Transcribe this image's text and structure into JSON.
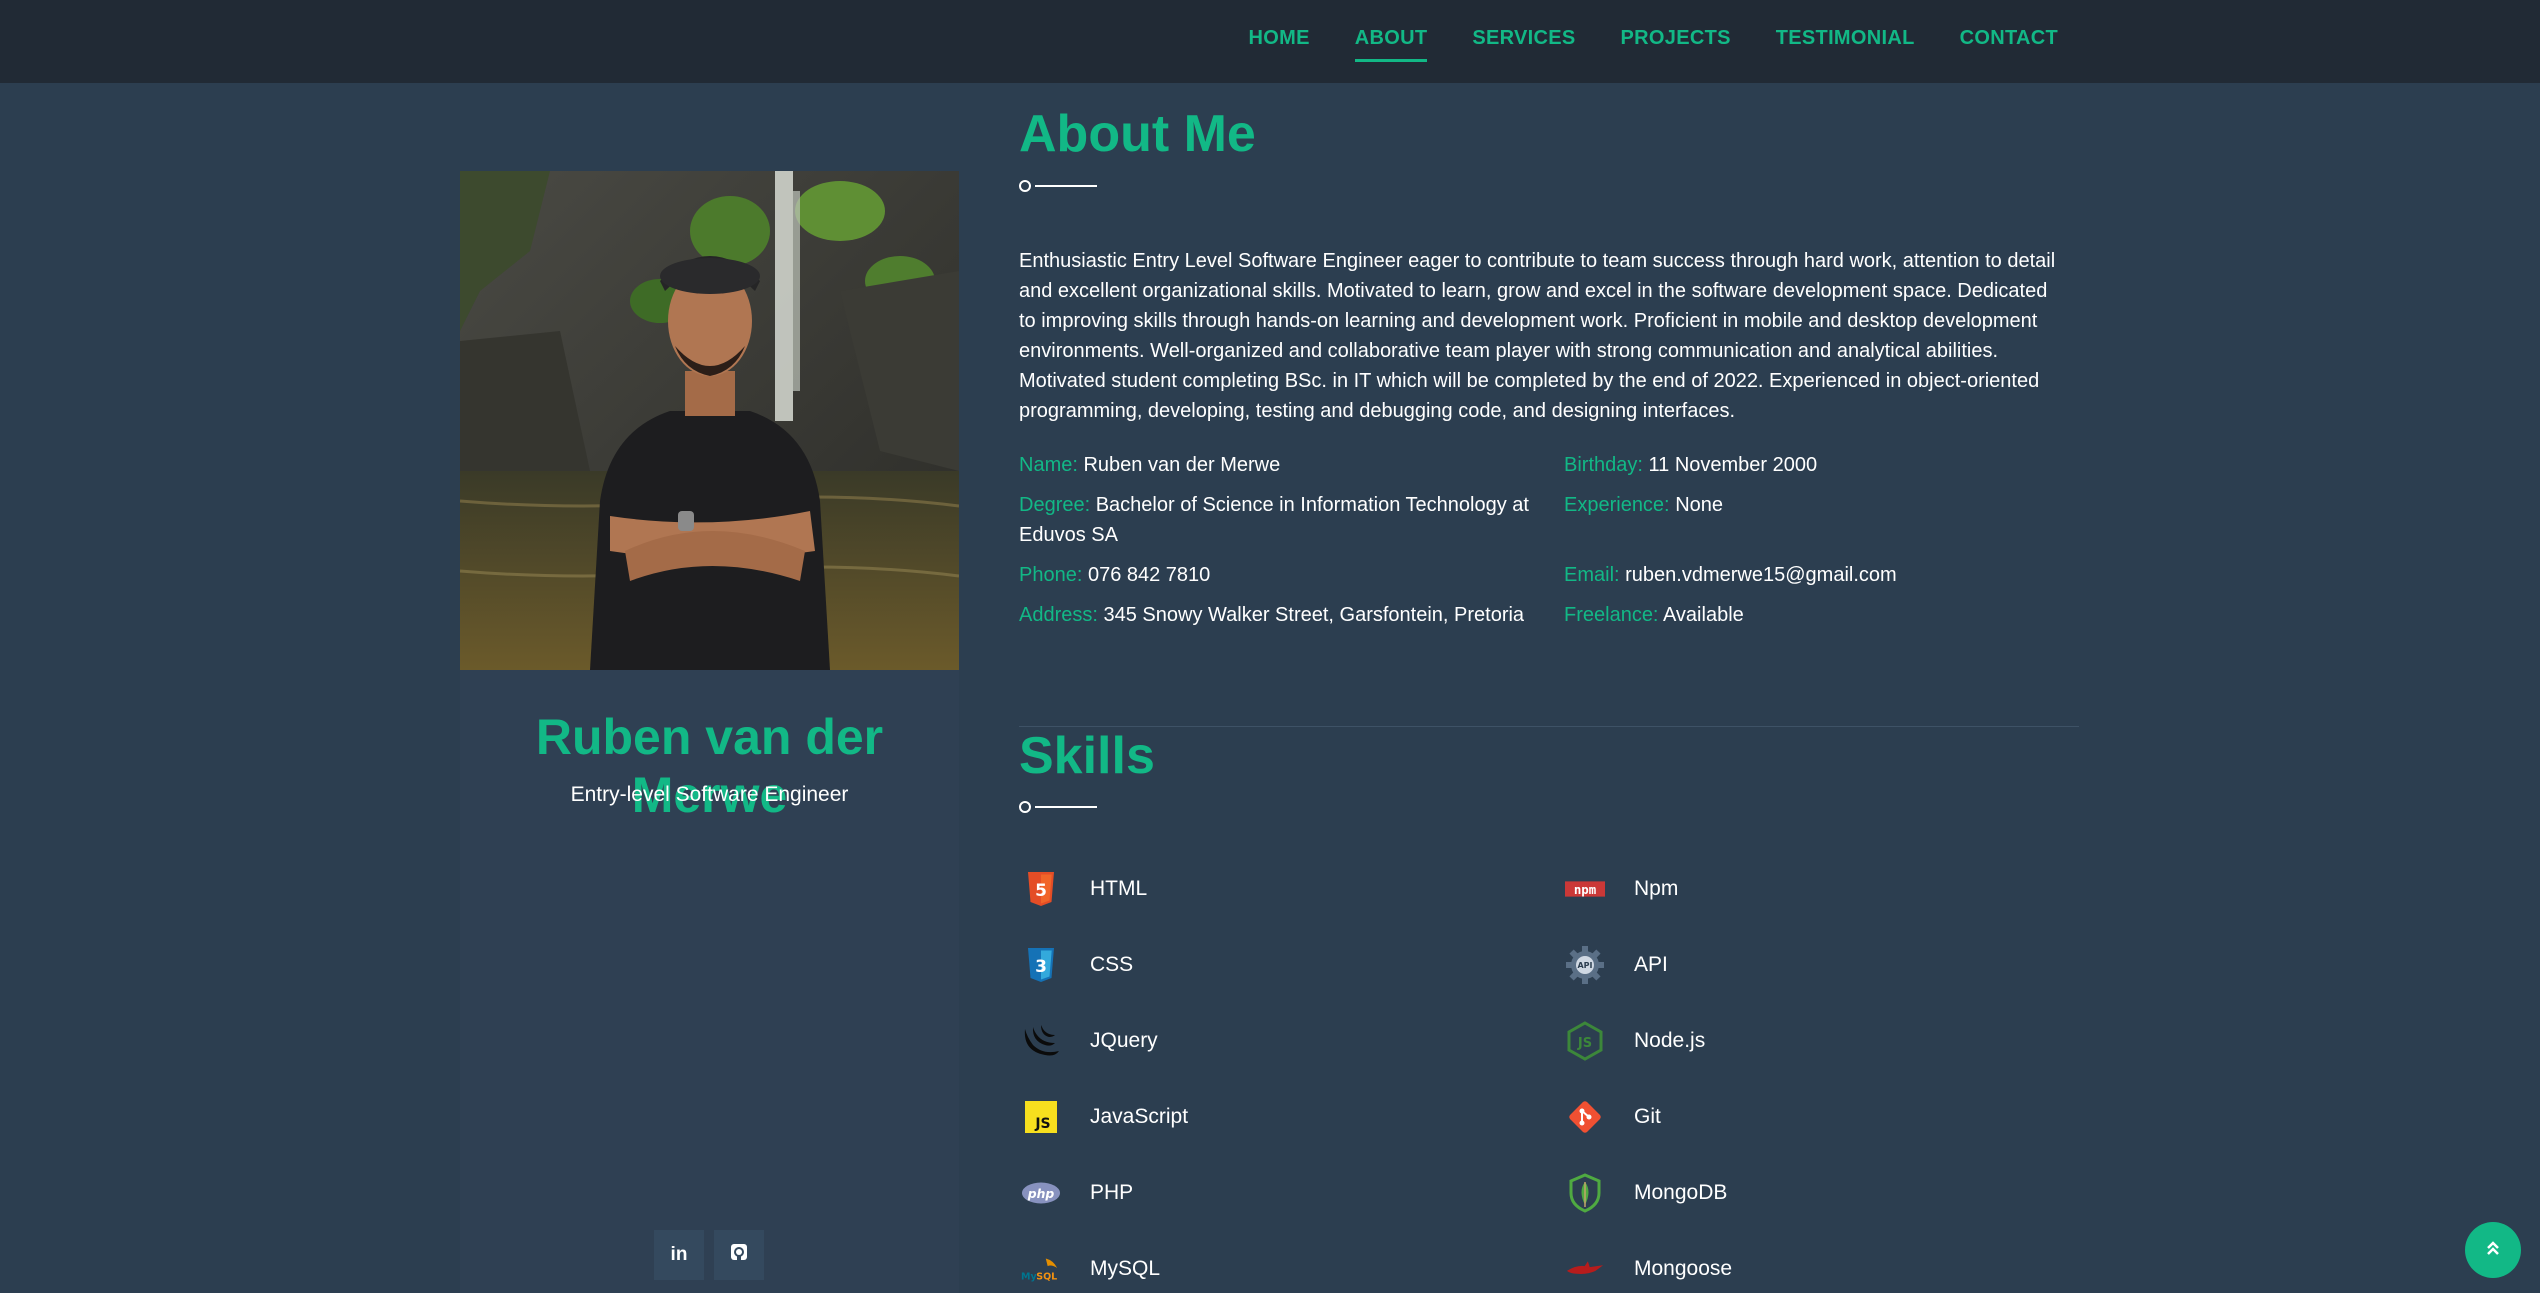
{
  "nav": {
    "items": [
      "HOME",
      "ABOUT",
      "SERVICES",
      "PROJECTS",
      "TESTIMONIAL",
      "CONTACT"
    ],
    "active": "ABOUT"
  },
  "profile": {
    "name": "Ruben van der Merwe",
    "role": "Entry-level Software Engineer",
    "social": [
      "linkedin-icon",
      "github-icon"
    ]
  },
  "about": {
    "title": "About Me",
    "text": "Enthusiastic Entry Level Software Engineer eager to contribute to team success through hard work, attention to detail and excellent organizational skills. Motivated to learn, grow and excel in the software development space. Dedicated to improving skills through hands-on learning and development work. Proficient in mobile and desktop development environments. Well-organized and collaborative team player with strong communication and analytical abilities. Motivated student completing BSc. in IT which will be completed by the end of 2022. Experienced in object-oriented programming, developing, testing and debugging code, and designing interfaces.",
    "info": {
      "name": {
        "label": "Name:",
        "value": "Ruben van der Merwe"
      },
      "birthday": {
        "label": "Birthday:",
        "value": "11 November 2000"
      },
      "degree": {
        "label": "Degree:",
        "value": "Bachelor of Science in Information Technology at Eduvos SA"
      },
      "experience": {
        "label": "Experience:",
        "value": "None"
      },
      "phone": {
        "label": "Phone:",
        "value": "076 842 7810"
      },
      "email": {
        "label": "Email:",
        "value": "ruben.vdmerwe15@gmail.com"
      },
      "address": {
        "label": "Address:",
        "value": "345 Snowy Walker Street, Garsfontein, Pretoria"
      },
      "freelance": {
        "label": "Freelance:",
        "value": "Available"
      }
    }
  },
  "skills": {
    "title": "Skills",
    "left": [
      {
        "name": "HTML",
        "icon": "html5-icon"
      },
      {
        "name": "CSS",
        "icon": "css3-icon"
      },
      {
        "name": "JQuery",
        "icon": "jquery-icon"
      },
      {
        "name": "JavaScript",
        "icon": "javascript-icon"
      },
      {
        "name": "PHP",
        "icon": "php-icon"
      },
      {
        "name": "MySQL",
        "icon": "mysql-icon"
      }
    ],
    "right": [
      {
        "name": "Npm",
        "icon": "npm-icon"
      },
      {
        "name": "API",
        "icon": "api-gear-icon"
      },
      {
        "name": "Node.js",
        "icon": "nodejs-icon"
      },
      {
        "name": "Git",
        "icon": "git-icon"
      },
      {
        "name": "MongoDB",
        "icon": "mongodb-icon"
      },
      {
        "name": "Mongoose",
        "icon": "mongoose-icon"
      }
    ]
  },
  "colors": {
    "accent": "#12b886",
    "background": "#2c3e50",
    "navbar": "#212a35",
    "card": "#2f4053"
  }
}
